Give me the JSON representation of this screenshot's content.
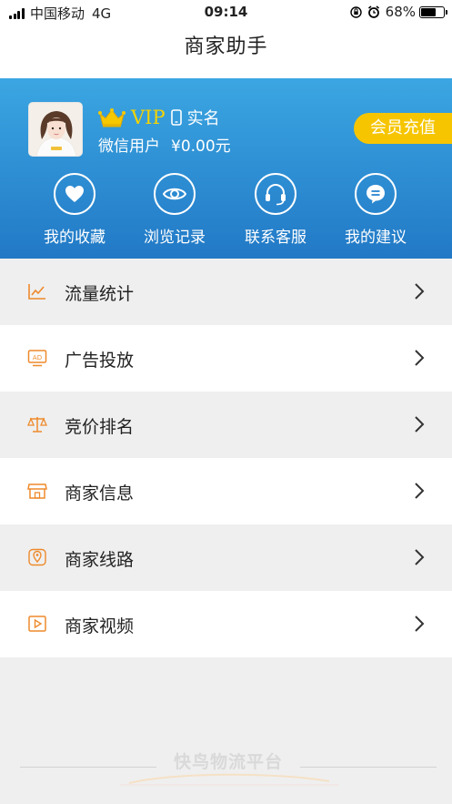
{
  "status_bar": {
    "carrier": "中国移动",
    "network": "4G",
    "time": "09:14",
    "battery": "68%",
    "battery_level": 0.68
  },
  "nav": {
    "title": "商家助手"
  },
  "profile": {
    "vip_label": "VIP",
    "realname_label": "实名",
    "username": "微信用户",
    "balance": "¥0.00元",
    "recharge_label": "会员充值"
  },
  "quick_actions": [
    {
      "label": "我的收藏",
      "icon": "heart-icon"
    },
    {
      "label": "浏览记录",
      "icon": "eye-icon"
    },
    {
      "label": "联系客服",
      "icon": "headset-icon"
    },
    {
      "label": "我的建议",
      "icon": "chat-bubble-icon"
    }
  ],
  "menu": [
    {
      "label": "流量统计",
      "icon": "line-chart-icon"
    },
    {
      "label": "广告投放",
      "icon": "ad-icon"
    },
    {
      "label": "竞价排名",
      "icon": "scale-icon"
    },
    {
      "label": "商家信息",
      "icon": "store-icon"
    },
    {
      "label": "商家线路",
      "icon": "location-pin-icon"
    },
    {
      "label": "商家视频",
      "icon": "video-icon"
    }
  ],
  "footer": {
    "brand": "快鸟物流平台"
  },
  "colors": {
    "banner_top": "#3ba6e2",
    "banner_bottom": "#2279c6",
    "accent_orange": "#ee8a2c",
    "vip_gold": "#f5d300",
    "recharge_yellow": "#f6c500"
  }
}
